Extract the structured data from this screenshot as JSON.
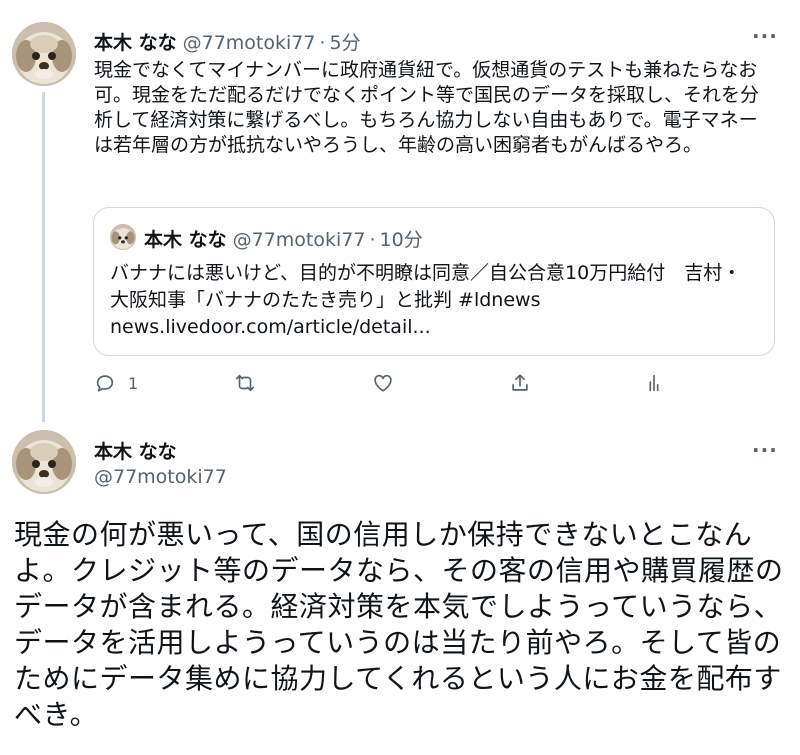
{
  "tweet1": {
    "name": "本木 なな",
    "handle": "@77motoki77",
    "separator": "·",
    "time": "5分",
    "text": "現金でなくてマイナンバーに政府通貨紐で。仮想通貨のテストも兼ねたらなお可。現金をただ配るだけでなくポイント等で国民のデータを採取し、それを分析して経済対策に繋げるべし。もちろん協力しない自由もありで。電子マネーは若年層の方が抵抗ないやろうし、年齢の高い困窮者もがんばるやろ。",
    "more": "···",
    "quote": {
      "name": "本木 なな",
      "handle": "@77motoki77",
      "separator": "·",
      "time": "10分",
      "text": "バナナには悪いけど、目的が不明瞭は同意／自公合意10万円給付　吉村・大阪知事「バナナのたたき売り」と批判 #ldnews",
      "link": "news.livedoor.com/article/detail..."
    },
    "actions": {
      "reply_count": "1",
      "reply_icon": "reply-icon",
      "retweet_icon": "retweet-icon",
      "like_icon": "heart-icon",
      "share_icon": "share-icon",
      "analytics_icon": "analytics-icon"
    }
  },
  "tweet2": {
    "name": "本木 なな",
    "handle": "@77motoki77",
    "more": "···",
    "text": "現金の何が悪いって、国の信用しか保持できないとこなんよ。クレジット等のデータなら、その客の信用や購買履歴のデータが含まれる。経済対策を本気でしようっていうなら、データを活用しようっていうのは当たり前やろ。そして皆のためにデータ集めに協力してくれるという人にお金を配布すべき。"
  },
  "colors": {
    "text": "#0f1419",
    "secondary": "#536471",
    "border": "#cfd9de"
  }
}
